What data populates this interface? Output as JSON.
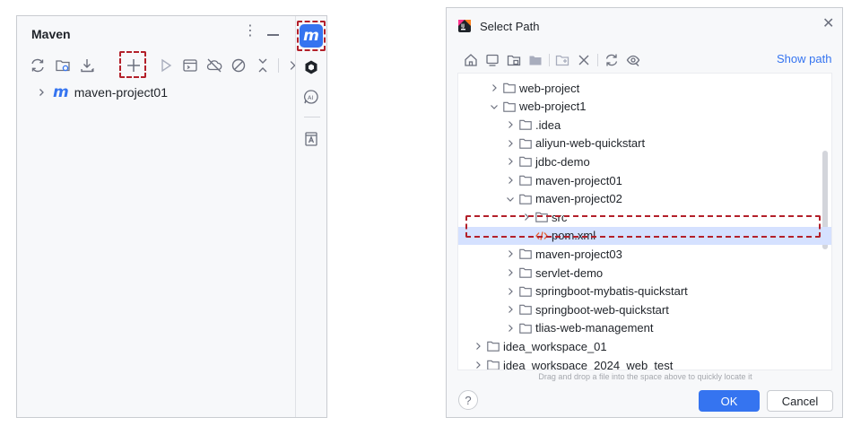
{
  "maven": {
    "title": "Maven",
    "project": "maven-project01",
    "icons": [
      "refresh-icon",
      "reload-folder-icon",
      "download-icon",
      "add-icon",
      "run-icon",
      "execute-goal-icon",
      "offline-icon",
      "skip-tests-icon",
      "collapse-icon",
      "more-chevron-icon"
    ],
    "strip_icons": [
      "maven-m-icon",
      "ai-chat-icon",
      "ai-assistant-icon",
      "notifications-icon"
    ],
    "m_letter": "m"
  },
  "dialog": {
    "title": "Select Path",
    "show_path": "Show path",
    "hint": "Drag and drop a file into the space above to quickly locate it",
    "ok": "OK",
    "cancel": "Cancel",
    "help": "?",
    "tree": [
      {
        "label": "web-project",
        "level": 2,
        "expanded": false
      },
      {
        "label": "web-project1",
        "level": 2,
        "expanded": true
      },
      {
        "label": ".idea",
        "level": 3,
        "expanded": false
      },
      {
        "label": "aliyun-web-quickstart",
        "level": 3,
        "expanded": false
      },
      {
        "label": "jdbc-demo",
        "level": 3,
        "expanded": false
      },
      {
        "label": "maven-project01",
        "level": 3,
        "expanded": false
      },
      {
        "label": "maven-project02",
        "level": 3,
        "expanded": true
      },
      {
        "label": "src",
        "level": 4,
        "expanded": false
      },
      {
        "label": "pom.xml",
        "level": 4,
        "file": true,
        "selected": true
      },
      {
        "label": "maven-project03",
        "level": 3,
        "expanded": false
      },
      {
        "label": "servlet-demo",
        "level": 3,
        "expanded": false
      },
      {
        "label": "springboot-mybatis-quickstart",
        "level": 3,
        "expanded": false
      },
      {
        "label": "springboot-web-quickstart",
        "level": 3,
        "expanded": false
      },
      {
        "label": "tlias-web-management",
        "level": 3,
        "expanded": false
      },
      {
        "label": "idea_workspace_01",
        "level": 1,
        "expanded": false
      },
      {
        "label": "idea_workspace_2024_web_test",
        "level": 1,
        "expanded": false
      }
    ]
  },
  "colors": {
    "accent": "#3574f0",
    "highlight_dash": "#b3202a",
    "selection": "#d5e1ff",
    "xml_icon": "#e55b2d"
  }
}
